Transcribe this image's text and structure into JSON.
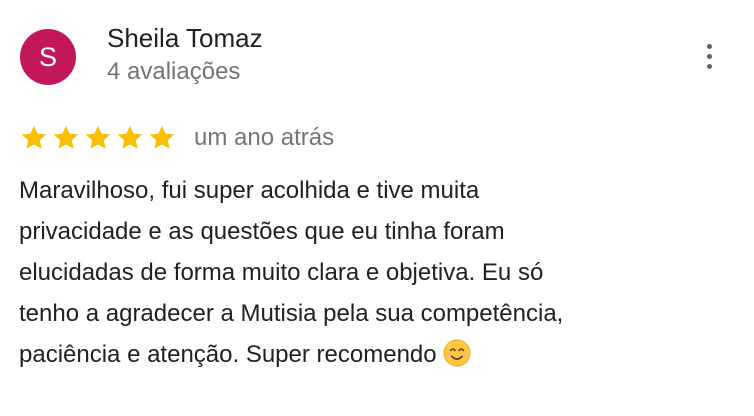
{
  "author": {
    "initial": "S",
    "name": "Sheila Tomaz",
    "review_count": "4 avaliações",
    "avatar_color": "#c2185b"
  },
  "menu": {
    "icon": "more-vert-icon"
  },
  "rating": {
    "stars": 5,
    "max_stars": 5,
    "star_color": "#fbbc04",
    "date": "um ano atrás"
  },
  "review": {
    "lines": [
      "Maravilhoso, fui super acolhida e tive muita",
      "privacidade e as questões que eu tinha foram",
      "elucidadas de forma muito clara e objetiva. Eu só",
      "tenho a agradecer a Mutisia pela sua competência,",
      "paciência e atenção. Super recomendo"
    ],
    "emoji": "smiling-face-icon"
  }
}
